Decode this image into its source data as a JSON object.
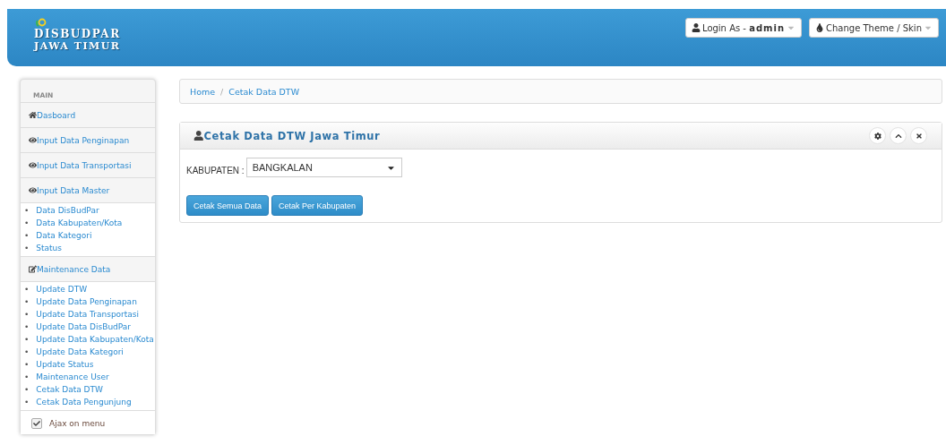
{
  "brand": {
    "line1": "DISBUDPAR",
    "line2": "JAWA TIMUR"
  },
  "header_buttons": [
    {
      "kind": "user",
      "prefix": "Login As - ",
      "value": "admin"
    },
    {
      "kind": "theme",
      "prefix": "Change Theme / Skin"
    }
  ],
  "sidebar": {
    "heading": "MAIN",
    "bullet": "•",
    "sections": [
      {
        "kind": "home",
        "label": "Dasboard"
      },
      {
        "kind": "view",
        "label": "Input Data Penginapan"
      },
      {
        "kind": "view",
        "label": "Input Data Transportasi"
      },
      {
        "kind": "view",
        "label": "Input Data Master",
        "items": [
          "Data DisBudPar",
          "Data Kabupaten/Kota",
          "Data Kategori",
          "Status"
        ]
      },
      {
        "kind": "edit",
        "label": "Maintenance Data",
        "items": [
          "Update DTW",
          "Update Data Penginapan",
          "Update Data Transportasi",
          "Update Data DisBudPar",
          "Update Data Kabupaten/Kota",
          "Update Data Kategori",
          "Update Status",
          "Maintenance User",
          "Cetak Data DTW",
          "Cetak Data Pengunjung"
        ]
      }
    ],
    "ajax": {
      "label": "Ajax on menu",
      "checked": true
    }
  },
  "breadcrumb": {
    "separator": "/",
    "items": [
      "Home",
      "Cetak Data DTW"
    ]
  },
  "panel": {
    "title": "Cetak Data DTW Jawa Timur",
    "field_label": "KABUPATEN :",
    "select_value": "BANGKALAN",
    "buttons": [
      "Cetak Semua Data",
      "Cetak Per Kabupaten"
    ]
  }
}
